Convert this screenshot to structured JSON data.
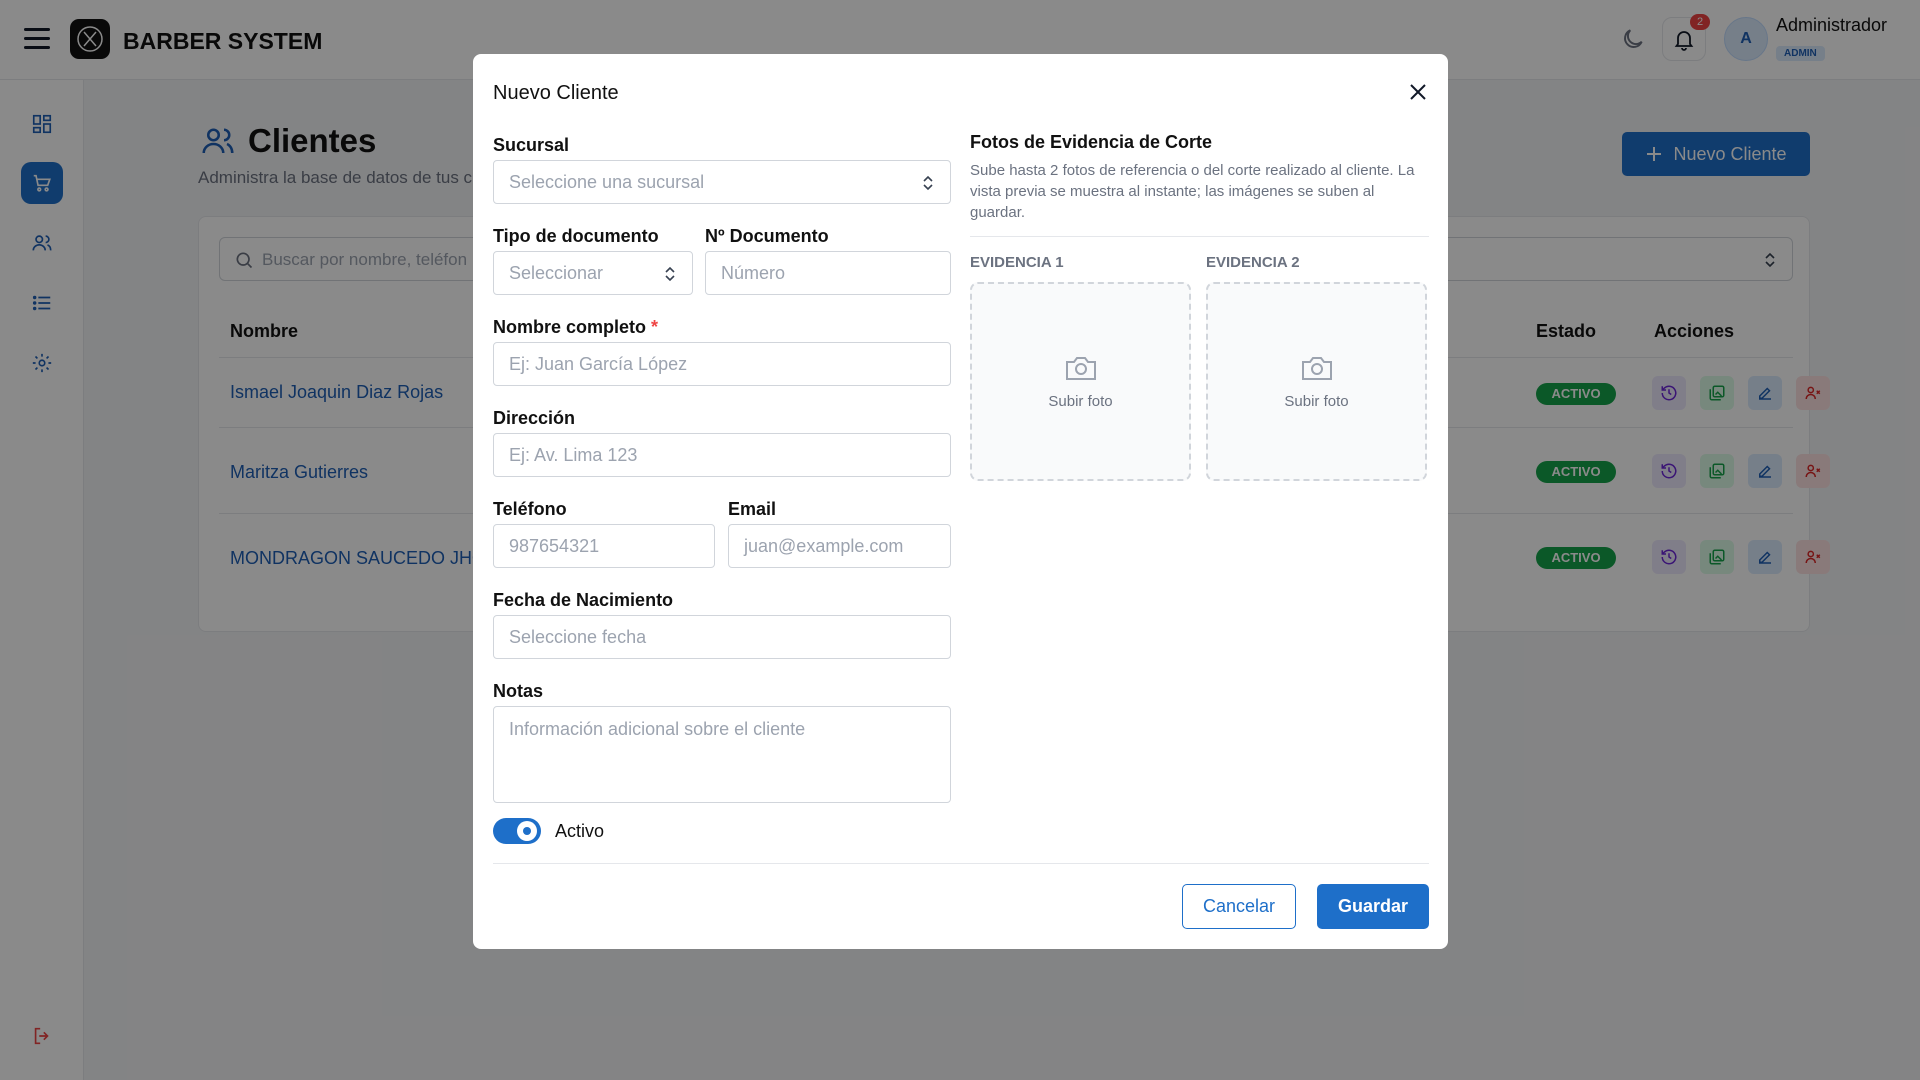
{
  "app": {
    "brand": "BARBER SYSTEM",
    "notifications": "2",
    "avatar_initial": "A",
    "user_name": "Administrador",
    "user_role": "ADMIN"
  },
  "sidebar": {
    "items": [
      {
        "icon": "dashboard-icon"
      },
      {
        "icon": "cart-icon",
        "active": true
      },
      {
        "icon": "users-icon"
      },
      {
        "icon": "list-icon"
      },
      {
        "icon": "gear-icon"
      }
    ],
    "logout_icon": "logout-icon"
  },
  "page": {
    "title": "Clientes",
    "subtitle": "Administra la base de datos de tus c",
    "new_button": "Nuevo Cliente"
  },
  "table": {
    "search_placeholder": "Buscar por nombre, teléfon",
    "headers": {
      "name": "Nombre",
      "status": "Estado",
      "actions": "Acciones"
    },
    "rows": [
      {
        "name": "Ismael Joaquin Diaz Rojas",
        "status": "ACTIVO"
      },
      {
        "name": "Maritza Gutierres",
        "status": "ACTIVO"
      },
      {
        "name": "MONDRAGON SAUCEDO JHOI",
        "status": "ACTIVO"
      }
    ]
  },
  "modal": {
    "title": "Nuevo Cliente",
    "sucursal": {
      "label": "Sucursal",
      "placeholder": "Seleccione una sucursal"
    },
    "tipo_doc": {
      "label": "Tipo de documento",
      "placeholder": "Seleccionar"
    },
    "num_doc": {
      "label": "Nº Documento",
      "placeholder": "Número"
    },
    "nombre": {
      "label": "Nombre completo",
      "required_mark": "*",
      "placeholder": "Ej: Juan García López"
    },
    "direccion": {
      "label": "Dirección",
      "placeholder": "Ej: Av. Lima 123"
    },
    "telefono": {
      "label": "Teléfono",
      "placeholder": "987654321"
    },
    "email": {
      "label": "Email",
      "placeholder": "juan@example.com"
    },
    "fecha": {
      "label": "Fecha de Nacimiento",
      "placeholder": "Seleccione fecha"
    },
    "notas": {
      "label": "Notas",
      "placeholder": "Información adicional sobre el cliente"
    },
    "activo": {
      "label": "Activo",
      "on": true
    },
    "photos": {
      "title": "Fotos de Evidencia de Corte",
      "description": "Sube hasta 2 fotos de referencia o del corte realizado al cliente. La vista previa se muestra al instante; las imágenes se suben al guardar.",
      "slots": [
        {
          "label": "EVIDENCIA 1",
          "upload": "Subir foto"
        },
        {
          "label": "EVIDENCIA 2",
          "upload": "Subir foto"
        }
      ]
    },
    "cancel": "Cancelar",
    "save": "Guardar"
  },
  "colors": {
    "primary": "#1e6fc9",
    "success": "#16a34a",
    "danger": "#ef4444",
    "overlay": "rgba(0,0,0,0.46)"
  }
}
